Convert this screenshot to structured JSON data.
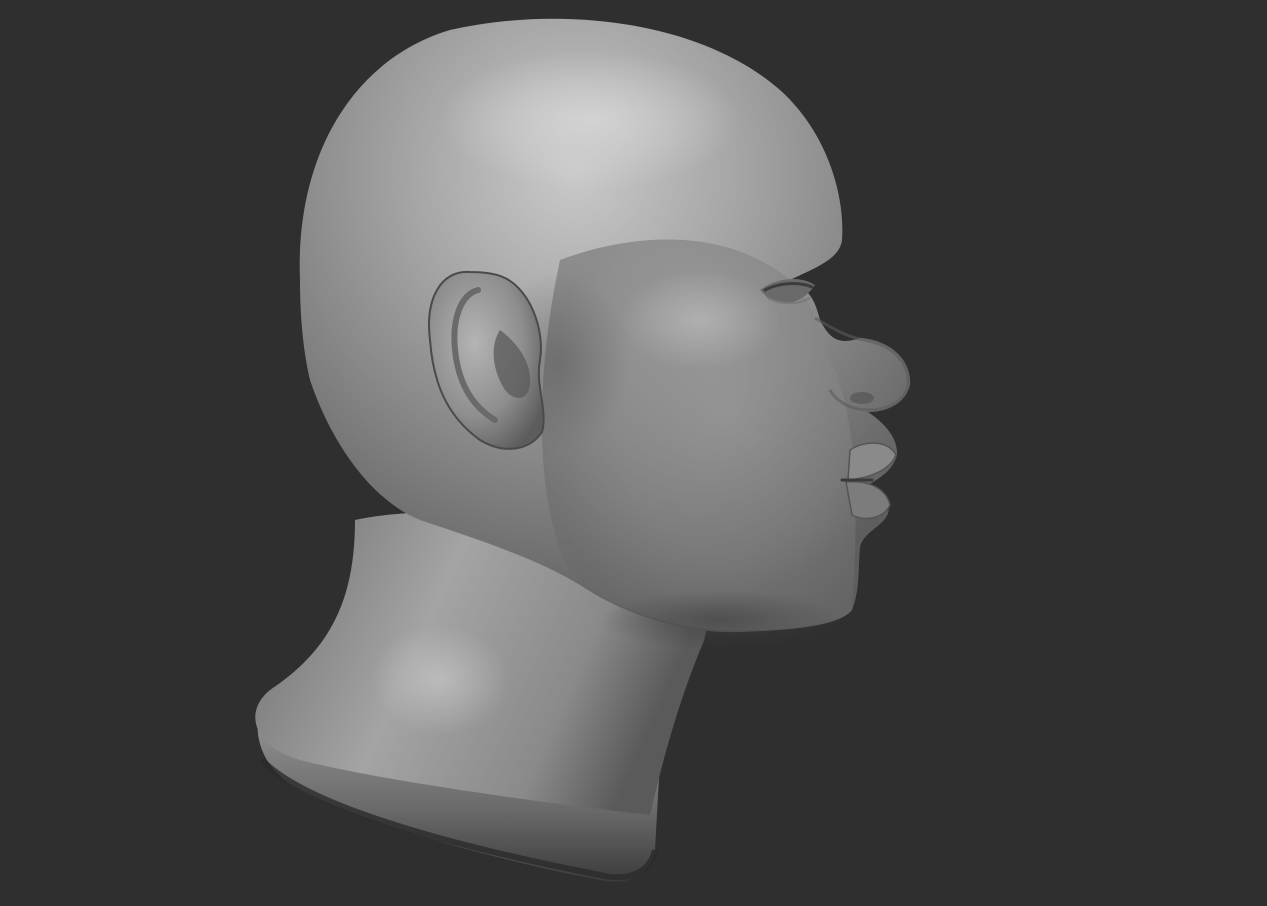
{
  "scene": {
    "subject": "head-bust-sculpt",
    "view": "right-profile",
    "background_color": "#2f2f2f",
    "material_color": "#8a8a8a",
    "highlight_color": "#c8c8c8",
    "shadow_color": "#3a3a3a"
  }
}
